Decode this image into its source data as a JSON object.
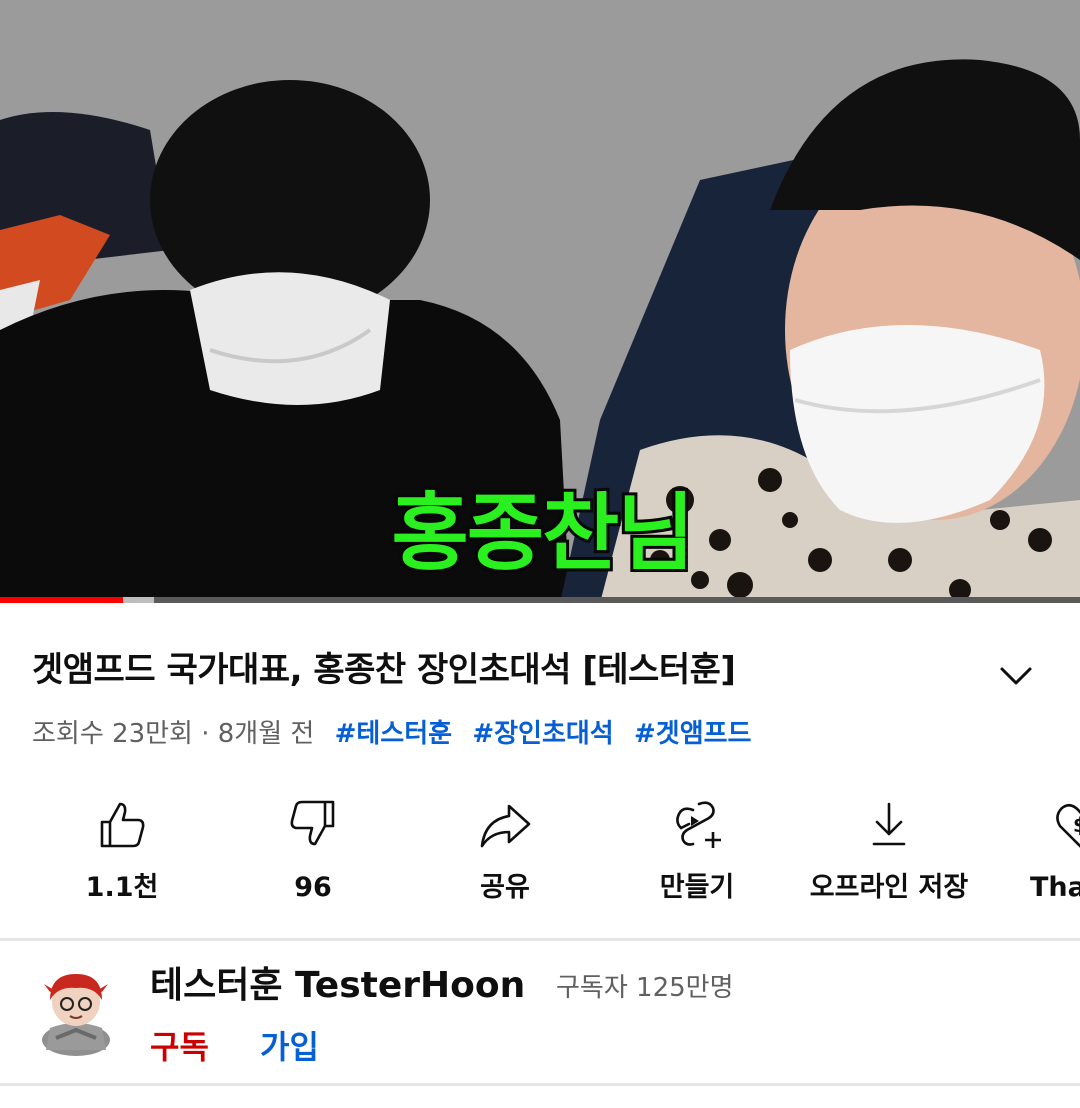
{
  "player": {
    "caption": "홍종찬님",
    "progress_played": 0.114,
    "progress_buffered": 0.143
  },
  "video": {
    "title": "겟앰프드 국가대표, 홍종찬 장인초대석 [테스터훈]",
    "views": "조회수 23만회",
    "separator": "·",
    "age": "8개월 전",
    "hashtags": [
      "#테스터훈",
      "#장인초대석",
      "#겟앰프드"
    ]
  },
  "actions": [
    {
      "icon": "thumbs-up-icon",
      "label": "1.1천"
    },
    {
      "icon": "thumbs-down-icon",
      "label": "96"
    },
    {
      "icon": "share-icon",
      "label": "공유"
    },
    {
      "icon": "remix-icon",
      "label": "만들기"
    },
    {
      "icon": "download-icon",
      "label": "오프라인 저장"
    },
    {
      "icon": "thanks-icon",
      "label": "Thanks"
    }
  ],
  "channel": {
    "name": "테스터훈 TesterHoon",
    "subscribers": "구독자 125만명",
    "subscribe_label": "구독",
    "join_label": "가입"
  },
  "colors": {
    "progress_played": "#ff0000",
    "caption": "#29f01e",
    "hashtag": "#065fd4",
    "subscribe": "#cc0000"
  }
}
